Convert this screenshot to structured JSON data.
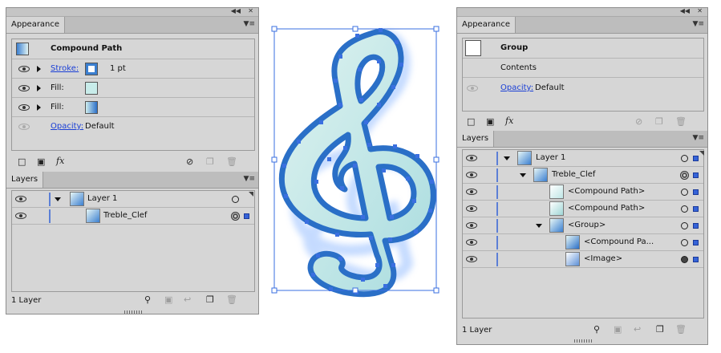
{
  "left_panel": {
    "appearance": {
      "tab": "Appearance",
      "object_type": "Compound Path",
      "stroke_label": "Stroke:",
      "stroke_weight": "1 pt",
      "fill1_label": "Fill:",
      "fill2_label": "Fill:",
      "opacity_label": "Opacity:",
      "opacity_value": "Default",
      "fx_label": "fx"
    },
    "layers": {
      "tab": "Layers",
      "rows": [
        {
          "name": "Layer 1"
        },
        {
          "name": "Treble_Clef"
        }
      ],
      "status": "1 Layer"
    }
  },
  "right_panel": {
    "appearance": {
      "tab": "Appearance",
      "object_type": "Group",
      "contents_label": "Contents",
      "opacity_label": "Opacity:",
      "opacity_value": "Default",
      "fx_label": "fx"
    },
    "layers": {
      "tab": "Layers",
      "rows": [
        {
          "name": "Layer 1"
        },
        {
          "name": "Treble_Clef"
        },
        {
          "name": "<Compound Path>"
        },
        {
          "name": "<Compound Path>"
        },
        {
          "name": "<Group>"
        },
        {
          "name": "<Compound Pa..."
        },
        {
          "name": "<Image>"
        }
      ],
      "status": "1 Layer"
    }
  },
  "colors": {
    "panel_bg": "#d6d6d6",
    "layer_color": "#5c7fd6",
    "selection_blue": "#3563d8",
    "link_blue": "#1a3fd6",
    "clef_fill": "#bfe6e6",
    "clef_stroke": "#2a6fc7"
  },
  "icons": [
    "eye-icon",
    "expand-arrow-icon",
    "new-art-basic-appearance-icon",
    "clear-appearance-icon",
    "fx-icon",
    "no-icon",
    "duplicate-icon",
    "trash-icon",
    "locate-object-icon",
    "make-clipping-mask-icon",
    "new-sublayer-icon",
    "new-layer-icon",
    "panel-menu-icon",
    "collapse-icon",
    "close-icon",
    "gripper-icon"
  ]
}
